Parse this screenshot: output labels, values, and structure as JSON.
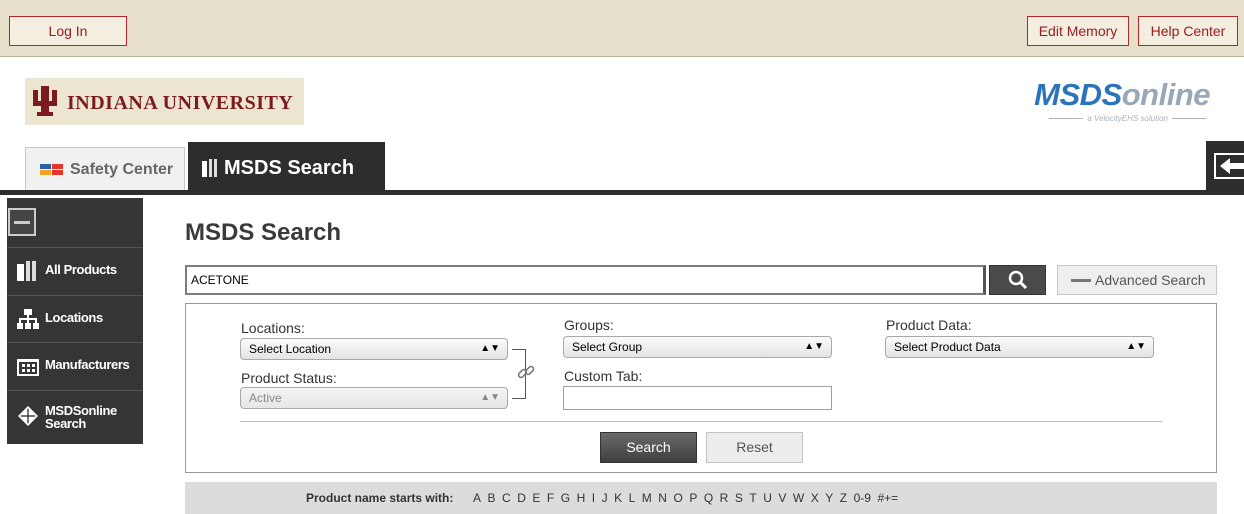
{
  "topbar": {
    "login_label": "Log In",
    "edit_memory_label": "Edit Memory",
    "help_center_label": "Help Center"
  },
  "branding": {
    "university_name": "INDIANA UNIVERSITY",
    "msds_logo_prefix": "MSDS",
    "msds_logo_suffix": "online",
    "msds_tagline": "a VelocityEHS solution"
  },
  "tabs": [
    {
      "label": "Safety Center"
    },
    {
      "label": "MSDS Search"
    }
  ],
  "sidebar": {
    "items": [
      {
        "label": "All Products"
      },
      {
        "label": "Locations"
      },
      {
        "label": "Manufacturers"
      },
      {
        "label_line1": "MSDSonline",
        "label_line2": "Search"
      }
    ]
  },
  "main": {
    "title": "MSDS Search",
    "search_value": "ACETONE",
    "advanced_search_label": "Advanced Search"
  },
  "filters": {
    "locations_label": "Locations:",
    "locations_value": "Select Location",
    "product_status_label": "Product Status:",
    "product_status_value": "Active",
    "groups_label": "Groups:",
    "groups_value": "Select Group",
    "custom_tab_label": "Custom Tab:",
    "custom_tab_value": "",
    "product_data_label": "Product Data:",
    "product_data_value": "Select Product Data",
    "search_label": "Search",
    "reset_label": "Reset"
  },
  "alphabet": {
    "lead": "Product name starts with:",
    "letters": [
      "A",
      "B",
      "C",
      "D",
      "E",
      "F",
      "G",
      "H",
      "I",
      "J",
      "K",
      "L",
      "M",
      "N",
      "O",
      "P",
      "Q",
      "R",
      "S",
      "T",
      "U",
      "V",
      "W",
      "X",
      "Y",
      "Z",
      "0-9",
      "#+="
    ]
  },
  "colors": {
    "topbar_bg": "#e6dfc9",
    "accent_red": "#9b1c20",
    "dark_nav": "#2d2d2d",
    "logo_blue": "#2b74bb"
  }
}
